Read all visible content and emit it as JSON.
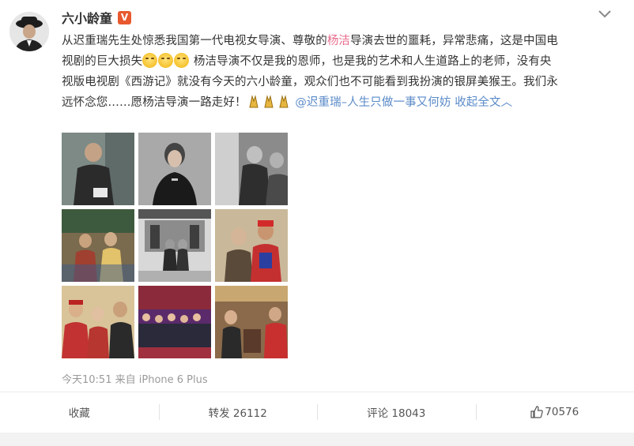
{
  "author": {
    "name": "六小龄童",
    "verified_badge": "V"
  },
  "post": {
    "line1": {
      "a": "从迟重瑞先生处惊悉我国第一代电视女导演、尊敬的",
      "b": "杨洁",
      "c": "导演去世的噩耗，异常悲痛，这是中国电"
    },
    "line2": {
      "a": "视剧的巨大损失",
      "b": "杨洁导演不仅是我的恩师，也是我的艺术和人生道路上的老师，没有央"
    },
    "line3": "视版电视剧《西游记》就没有今天的六小龄童，观众们也不可能看到我扮演的银屏美猴王。我们永",
    "line4": {
      "a": "远怀念您……愿杨洁导演一路走好！",
      "mention": "@迟重瑞–人生只做一事又何妨",
      "collapse": "收起全文",
      "collapse_arrow": "︿"
    }
  },
  "photos": [
    "photo-1",
    "photo-2",
    "photo-3",
    "photo-4",
    "photo-5",
    "photo-6",
    "photo-7",
    "photo-8",
    "photo-9"
  ],
  "meta": {
    "time": "今天10:51",
    "source_prefix": "来自",
    "source": "iPhone 6 Plus"
  },
  "actions": {
    "favorite": "收藏",
    "repost": "转发 26112",
    "comment": "评论 18043",
    "like": "70576"
  },
  "colors": {
    "highlight": "#e86a8c",
    "link": "#eb7350",
    "badge": "#e8592e"
  }
}
